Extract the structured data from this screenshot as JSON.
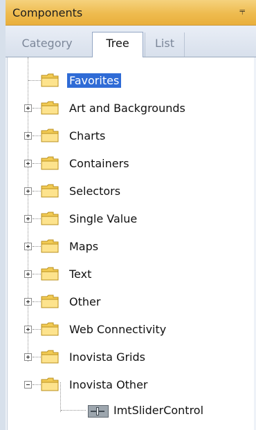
{
  "panel": {
    "title": "Components",
    "pin_icon": "pin-icon"
  },
  "tabs": [
    {
      "label": "Category",
      "active": false
    },
    {
      "label": "Tree",
      "active": true
    },
    {
      "label": "List",
      "active": false
    }
  ],
  "tree": {
    "items": [
      {
        "label": "Favorites",
        "expander": "none",
        "selected": true
      },
      {
        "label": "Art and Backgrounds",
        "expander": "plus",
        "selected": false
      },
      {
        "label": "Charts",
        "expander": "plus",
        "selected": false
      },
      {
        "label": "Containers",
        "expander": "plus",
        "selected": false
      },
      {
        "label": "Selectors",
        "expander": "plus",
        "selected": false
      },
      {
        "label": "Single Value",
        "expander": "plus",
        "selected": false
      },
      {
        "label": "Maps",
        "expander": "plus",
        "selected": false
      },
      {
        "label": "Text",
        "expander": "plus",
        "selected": false
      },
      {
        "label": "Other",
        "expander": "plus",
        "selected": false
      },
      {
        "label": "Web Connectivity",
        "expander": "plus",
        "selected": false
      },
      {
        "label": "Inovista Grids",
        "expander": "plus",
        "selected": false
      },
      {
        "label": "Inovista Other",
        "expander": "minus",
        "selected": false
      }
    ],
    "child": {
      "label": "ImtSliderControl",
      "icon": "slider-control-icon"
    }
  },
  "colors": {
    "title_bar": "#eebb4f",
    "selection": "#2f6bd6",
    "folder": "#f4d36c"
  }
}
